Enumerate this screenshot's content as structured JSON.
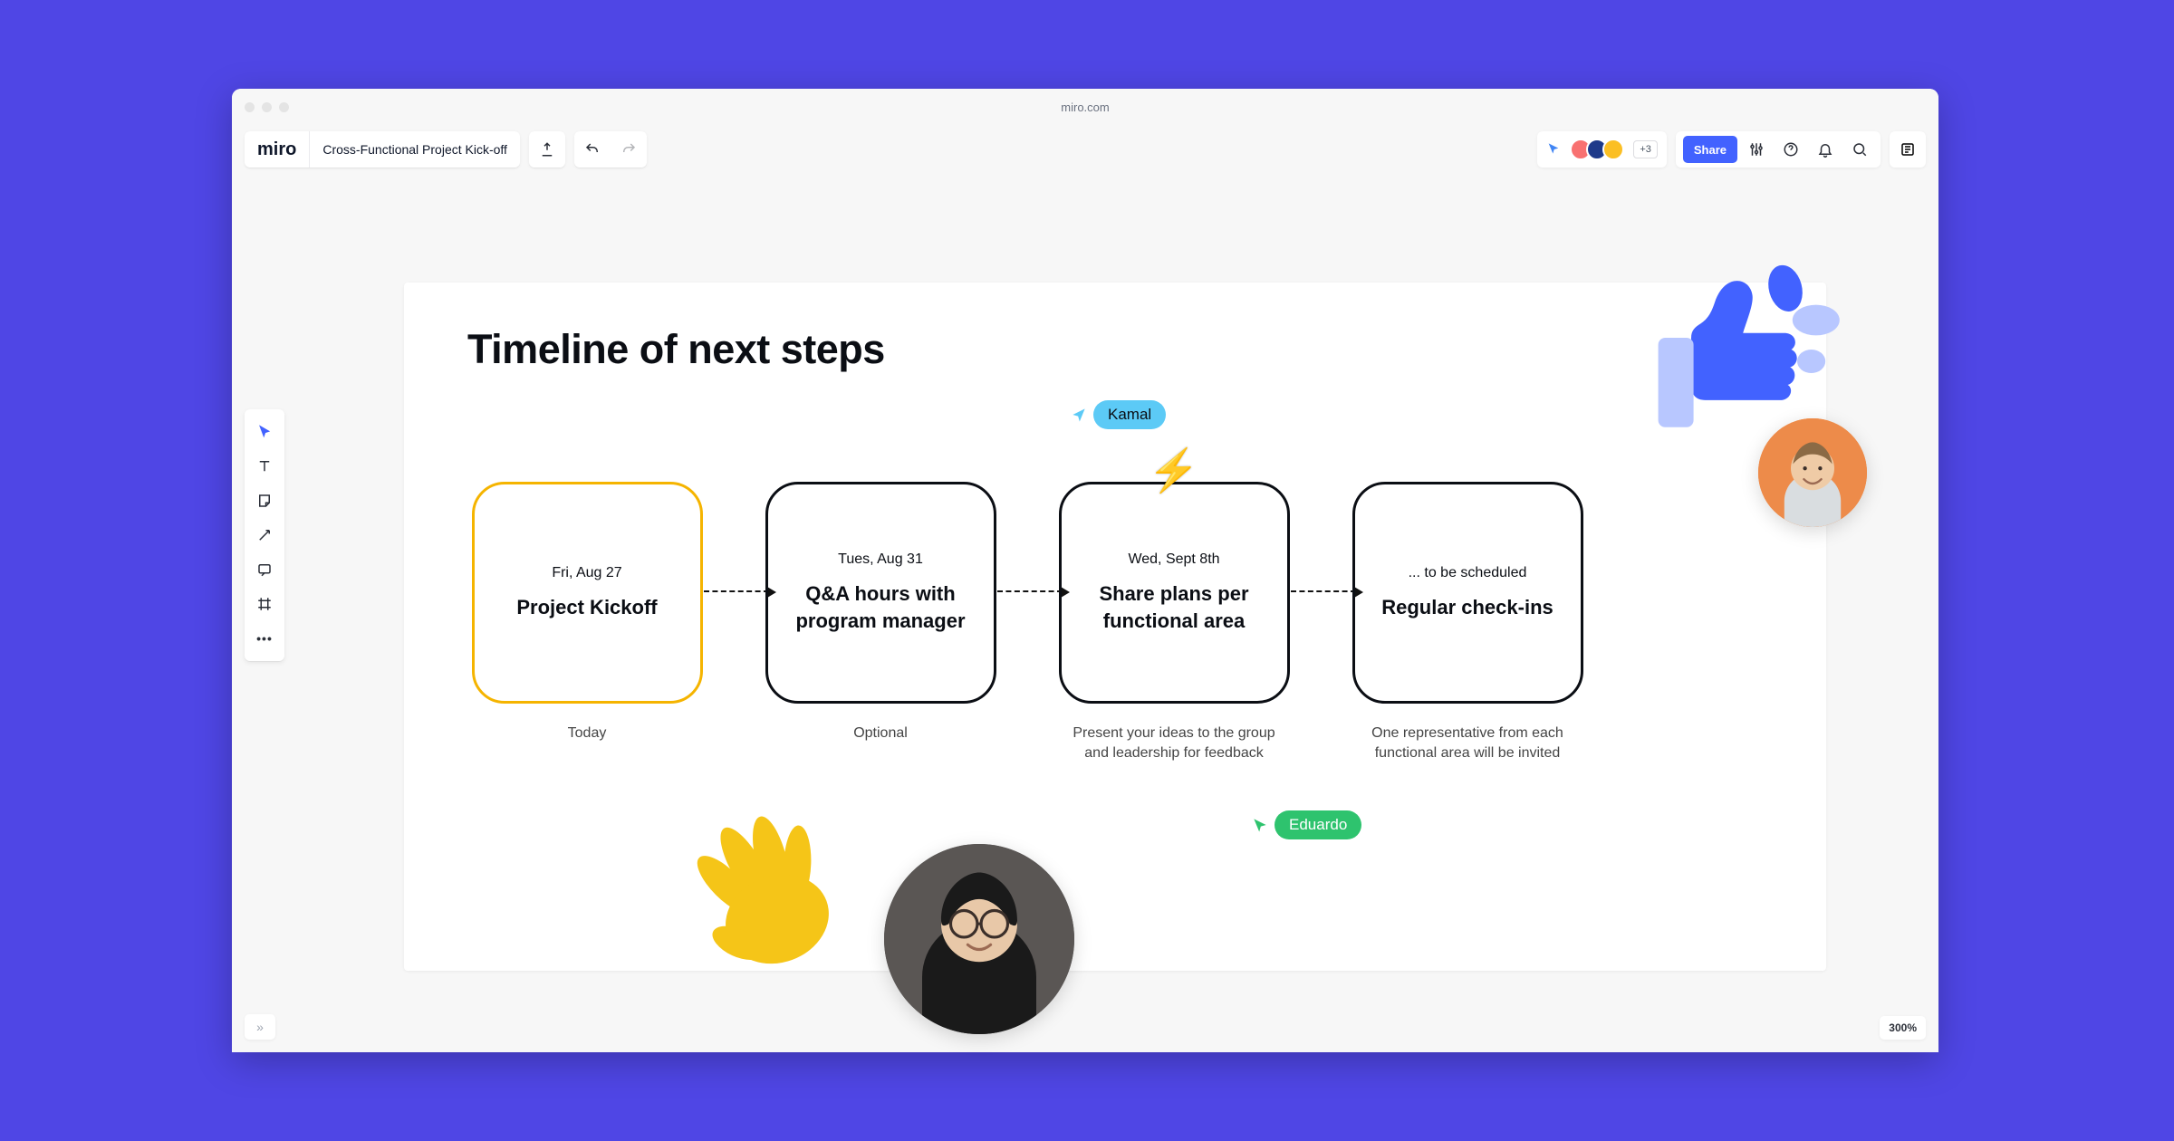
{
  "browser": {
    "url": "miro.com"
  },
  "header": {
    "logo": "miro",
    "board_name": "Cross-Functional Project Kick-off",
    "share_label": "Share",
    "more_count": "+3"
  },
  "collaborators": {
    "kamal": "Kamal",
    "eduardo": "Eduardo"
  },
  "frame": {
    "title": "Timeline of next steps"
  },
  "timeline": [
    {
      "date": "Fri, Aug 27",
      "title": "Project Kickoff",
      "caption": "Today",
      "highlight": true
    },
    {
      "date": "Tues, Aug 31",
      "title": "Q&A hours with program manager",
      "caption": "Optional",
      "highlight": false
    },
    {
      "date": "Wed, Sept 8th",
      "title": "Share plans per functional area",
      "caption": "Present your ideas to the group and leadership for feedback",
      "highlight": false,
      "lightning": true
    },
    {
      "date": "... to be scheduled",
      "title": "Regular check-ins",
      "caption": "One representative from each functional area will be invited",
      "highlight": false
    }
  ],
  "zoom": "300%",
  "avatars_colors": [
    "#f87171",
    "#1e3a8a",
    "#fbbf24"
  ]
}
